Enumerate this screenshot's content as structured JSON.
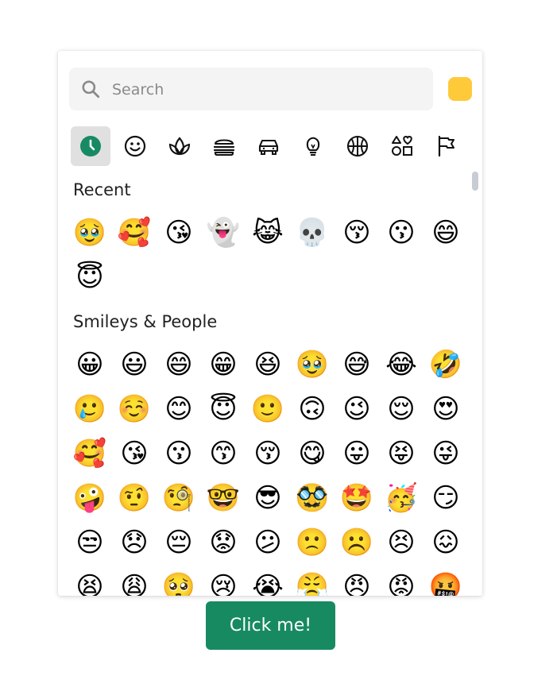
{
  "search": {
    "placeholder": "Search"
  },
  "skin_tone": {
    "color": "#ffca3a"
  },
  "categories": [
    {
      "icon": "clock-icon",
      "active": true
    },
    {
      "icon": "smiley-icon"
    },
    {
      "icon": "leaf-icon"
    },
    {
      "icon": "burger-icon"
    },
    {
      "icon": "car-icon"
    },
    {
      "icon": "lightbulb-icon"
    },
    {
      "icon": "basketball-icon"
    },
    {
      "icon": "symbols-icon"
    },
    {
      "icon": "flag-icon"
    }
  ],
  "sections": [
    {
      "title": "Recent",
      "emojis": [
        "🥹",
        "🥰",
        "😘",
        "👻",
        "😹",
        "💀",
        "😚",
        "😗",
        "😄",
        "😇"
      ]
    },
    {
      "title": "Smileys & People",
      "emojis": [
        "😀",
        "😃",
        "😄",
        "😁",
        "😆",
        "🥹",
        "😅",
        "😂",
        "🤣",
        "🥲",
        "☺️",
        "😊",
        "😇",
        "🙂",
        "🙃",
        "😉",
        "😌",
        "😍",
        "🥰",
        "😘",
        "😗",
        "😙",
        "😚",
        "😋",
        "😛",
        "😝",
        "😜",
        "🤪",
        "🤨",
        "🧐",
        "🤓",
        "😎",
        "🥸",
        "🤩",
        "🥳",
        "😏",
        "😒",
        "😞",
        "😔",
        "😟",
        "😕",
        "🙁",
        "☹️",
        "😣",
        "😖",
        "😫",
        "😩",
        "🥺",
        "😢",
        "😭",
        "😤",
        "😠",
        "😡",
        "🤬"
      ]
    }
  ],
  "button": {
    "label": "Click me!"
  },
  "colors": {
    "accent": "#178a62",
    "clock_active": "#178a62"
  }
}
